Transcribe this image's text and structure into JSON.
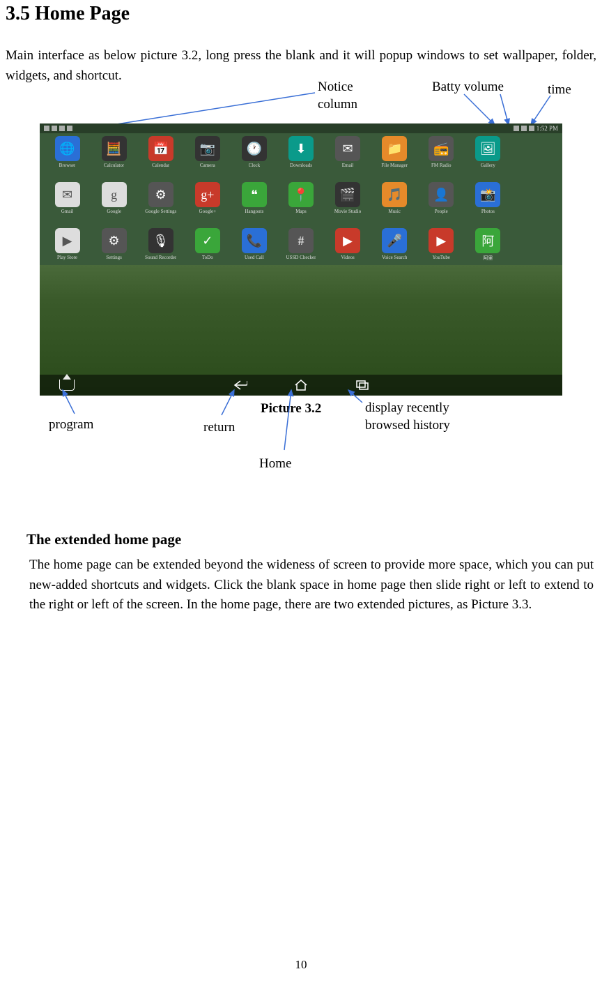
{
  "section_title": "3.5 Home Page",
  "intro_text": "Main interface as below picture 3.2, long press the blank and it will popup windows to set wallpaper, folder, widgets, and shortcut.",
  "top_labels": {
    "notice": "Notice column",
    "batty": "Batty volume",
    "time": "time"
  },
  "caption": "Picture 3.2",
  "bottom_labels": {
    "program": "program",
    "return": "return",
    "home": "Home",
    "recent": "display recently browsed history"
  },
  "subheading": "The extended home page",
  "body2": "The home page can be extended beyond the wideness of screen to provide more space, which you can put new-added shortcuts and widgets. Click the blank space in home page then slide right or left to extend to the right or left of the screen. In the home page, there are two extended pictures, as Picture 3.3.",
  "page_number": "10",
  "statusbar_time": "1:52 PM",
  "apps_row1": [
    {
      "label": "Browser",
      "c": "c-blue",
      "g": "🌐"
    },
    {
      "label": "Calculator",
      "c": "c-dark",
      "g": "🧮"
    },
    {
      "label": "Calendar",
      "c": "c-red",
      "g": "📅"
    },
    {
      "label": "Camera",
      "c": "c-dark",
      "g": "📷"
    },
    {
      "label": "Clock",
      "c": "c-dark",
      "g": "🕐"
    },
    {
      "label": "Downloads",
      "c": "c-teal",
      "g": "⬇"
    },
    {
      "label": "Email",
      "c": "c-gray",
      "g": "✉"
    },
    {
      "label": "File Manager",
      "c": "c-orange",
      "g": "📁"
    },
    {
      "label": "FM Radio",
      "c": "c-gray",
      "g": "📻"
    },
    {
      "label": "Gallery",
      "c": "c-teal",
      "g": "🖼"
    },
    {
      "label": "",
      "c": "",
      "g": ""
    }
  ],
  "apps_row2": [
    {
      "label": "Gmail",
      "c": "c-white",
      "g": "✉"
    },
    {
      "label": "Google",
      "c": "c-white",
      "g": "g"
    },
    {
      "label": "Google Settings",
      "c": "c-gray",
      "g": "⚙"
    },
    {
      "label": "Google+",
      "c": "c-red",
      "g": "g+"
    },
    {
      "label": "Hangouts",
      "c": "c-green",
      "g": "❝"
    },
    {
      "label": "Maps",
      "c": "c-green",
      "g": "📍"
    },
    {
      "label": "Movie Studio",
      "c": "c-dark",
      "g": "🎬"
    },
    {
      "label": "Music",
      "c": "c-orange",
      "g": "🎵"
    },
    {
      "label": "People",
      "c": "c-gray",
      "g": "👤"
    },
    {
      "label": "Photos",
      "c": "c-blue",
      "g": "📸"
    },
    {
      "label": "",
      "c": "",
      "g": ""
    }
  ],
  "apps_row3": [
    {
      "label": "Play Store",
      "c": "c-white",
      "g": "▶"
    },
    {
      "label": "Settings",
      "c": "c-gray",
      "g": "⚙"
    },
    {
      "label": "Sound Recorder",
      "c": "c-dark",
      "g": "🎙"
    },
    {
      "label": "ToDo",
      "c": "c-green",
      "g": "✓"
    },
    {
      "label": "Used Call",
      "c": "c-blue",
      "g": "📞"
    },
    {
      "label": "USSD Checker",
      "c": "c-gray",
      "g": "#"
    },
    {
      "label": "Videos",
      "c": "c-red",
      "g": "▶"
    },
    {
      "label": "Voice Search",
      "c": "c-blue",
      "g": "🎤"
    },
    {
      "label": "YouTube",
      "c": "c-red",
      "g": "▶"
    },
    {
      "label": "阿里",
      "c": "c-green",
      "g": "阿"
    },
    {
      "label": "",
      "c": "",
      "g": ""
    }
  ]
}
